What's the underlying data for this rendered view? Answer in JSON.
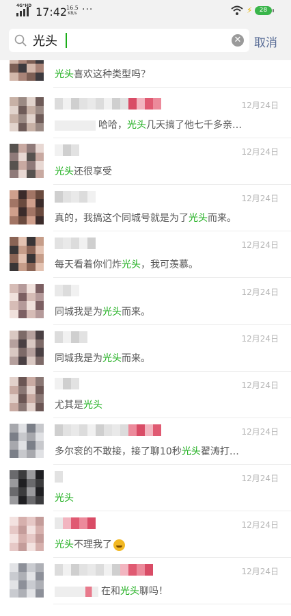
{
  "status_bar": {
    "network": "4G⁺HD",
    "time": "17:42",
    "speed_value": "16.5",
    "speed_unit": "KB/s",
    "more": "···",
    "battery": "28"
  },
  "search": {
    "query": "光头",
    "cancel_label": "取消"
  },
  "results": [
    {
      "pre": "",
      "hl": "光头",
      "post": "喜欢这种类型吗？",
      "date": "12月24日"
    },
    {
      "pre": "哈哈，",
      "hl": "光头",
      "post": "几天搞了他七千多亲…",
      "date": "12月24日"
    },
    {
      "pre": "",
      "hl": "光头",
      "post": "还很享受",
      "date": "12月24日"
    },
    {
      "pre": "真的，我搞这个同城号就是为了",
      "hl": "光头",
      "post": "而来。",
      "date": "12月24日"
    },
    {
      "pre": "每天看着你们炸",
      "hl": "光头",
      "post": "，我可羡慕。",
      "date": "12月24日"
    },
    {
      "pre": "同城我是为",
      "hl": "光头",
      "post": "而来。",
      "date": "12月24日"
    },
    {
      "pre": "同城我是为",
      "hl": "光头",
      "post": "而来。",
      "date": "12月24日"
    },
    {
      "pre": "尤其是",
      "hl": "光头",
      "post": "",
      "date": "12月24日"
    },
    {
      "pre": "多尔衮的不敢接，接了聊10秒",
      "hl": "光头",
      "post": "翟涛打…",
      "date": "12月24日"
    },
    {
      "pre": "",
      "hl": "光头",
      "post": "",
      "date": "12月24日"
    },
    {
      "pre": "",
      "hl": "光头",
      "post": "不理我了",
      "date": "12月24日"
    },
    {
      "pre": "在和",
      "hl": "光头",
      "post": "聊吗！",
      "date": "12月24日"
    }
  ],
  "colors": {
    "highlight": "#1aad19",
    "cancel": "#576b95",
    "date": "#b5b5b5"
  },
  "icons": [
    "signal-icon",
    "wifi-icon",
    "charging-icon",
    "search-icon",
    "clear-icon",
    "emoji-icon"
  ]
}
